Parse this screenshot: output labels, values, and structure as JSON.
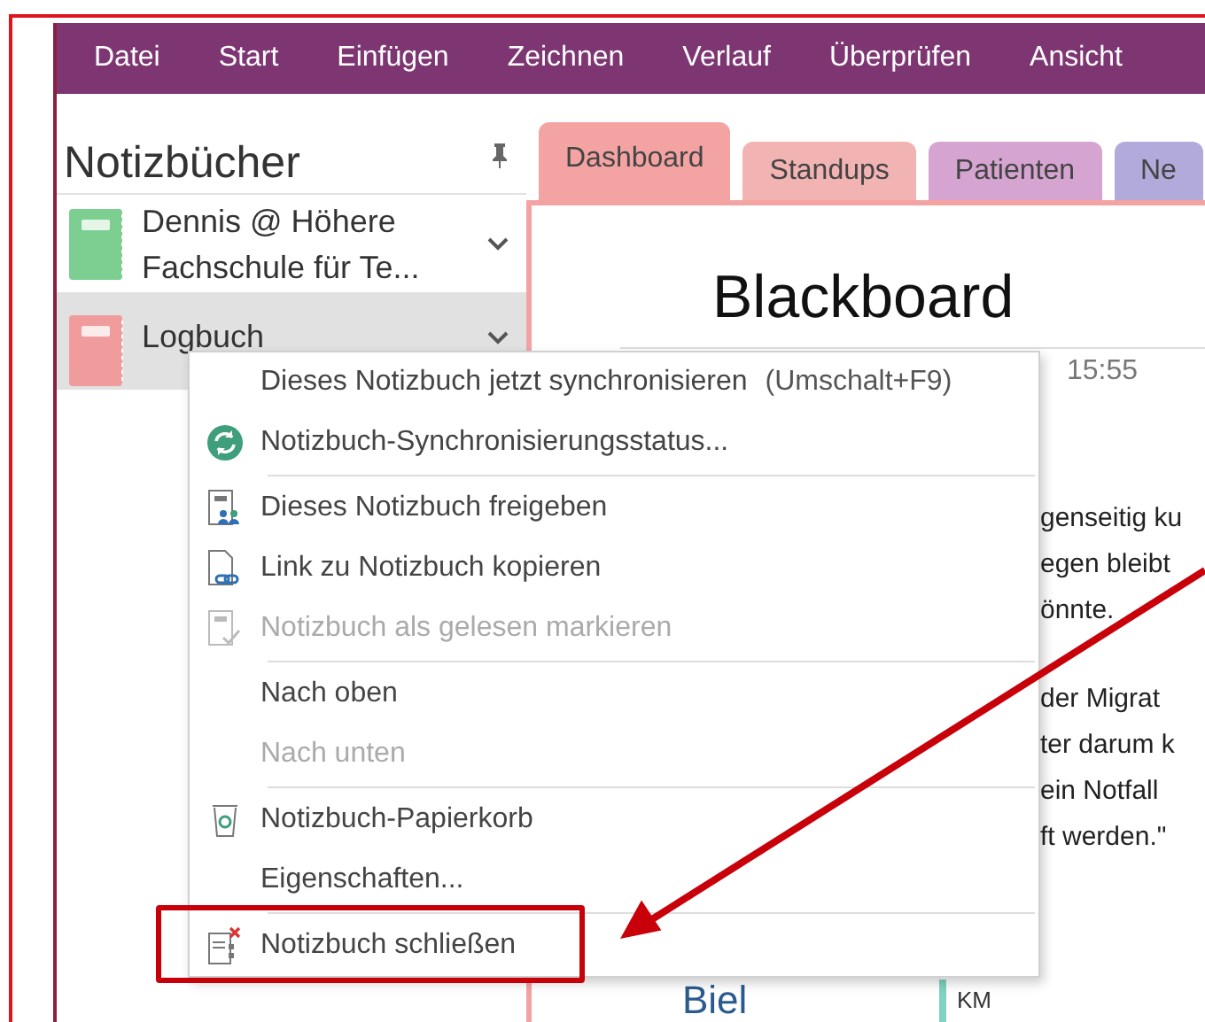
{
  "menu_bar": {
    "items": [
      "Datei",
      "Start",
      "Einfügen",
      "Zeichnen",
      "Verlauf",
      "Überprüfen",
      "Ansicht"
    ]
  },
  "sidebar": {
    "title": "Notizbücher",
    "notebooks": [
      {
        "name": "Dennis @ Höhere Fachschule für Te...",
        "selected": false,
        "color": "#7ccf91"
      },
      {
        "name": "Logbuch",
        "selected": true,
        "color": "#f19c9c"
      }
    ]
  },
  "section_tabs": [
    {
      "label": "Dashboard",
      "selected": true,
      "color": "#f4a3a3"
    },
    {
      "label": "Standups",
      "selected": false,
      "color": "#f2b3b3"
    },
    {
      "label": "Patienten",
      "selected": false,
      "color": "#d5a4d0"
    },
    {
      "label": "Ne",
      "selected": false,
      "color": "#b1aadb"
    }
  ],
  "page": {
    "title": "Blackboard",
    "time": "15:55",
    "paragraphs": [
      [
        "genseitig ku",
        "egen bleibt",
        "önnte."
      ],
      [
        "der Migrat",
        "ter darum k",
        "ein Notfall",
        "ft werden.\""
      ]
    ],
    "footer_left": "Biel",
    "footer_right": "KM"
  },
  "context_menu": {
    "groups": [
      [
        {
          "label": "Dieses Notizbuch jetzt synchronisieren",
          "shortcut": "(Umschalt+F9)",
          "disabled": false
        },
        {
          "label": "Notizbuch-Synchronisierungsstatus...",
          "disabled": false
        }
      ],
      [
        {
          "label": "Dieses Notizbuch freigeben",
          "disabled": false
        },
        {
          "label": "Link zu Notizbuch kopieren",
          "disabled": false
        },
        {
          "label": "Notizbuch als gelesen markieren",
          "disabled": true
        }
      ],
      [
        {
          "label": "Nach oben",
          "disabled": false
        },
        {
          "label": "Nach unten",
          "disabled": true
        }
      ],
      [
        {
          "label": "Notizbuch-Papierkorb",
          "disabled": false
        },
        {
          "label": "Eigenschaften...",
          "disabled": false
        }
      ],
      [
        {
          "label": "Notizbuch schließen",
          "disabled": false
        }
      ]
    ]
  }
}
